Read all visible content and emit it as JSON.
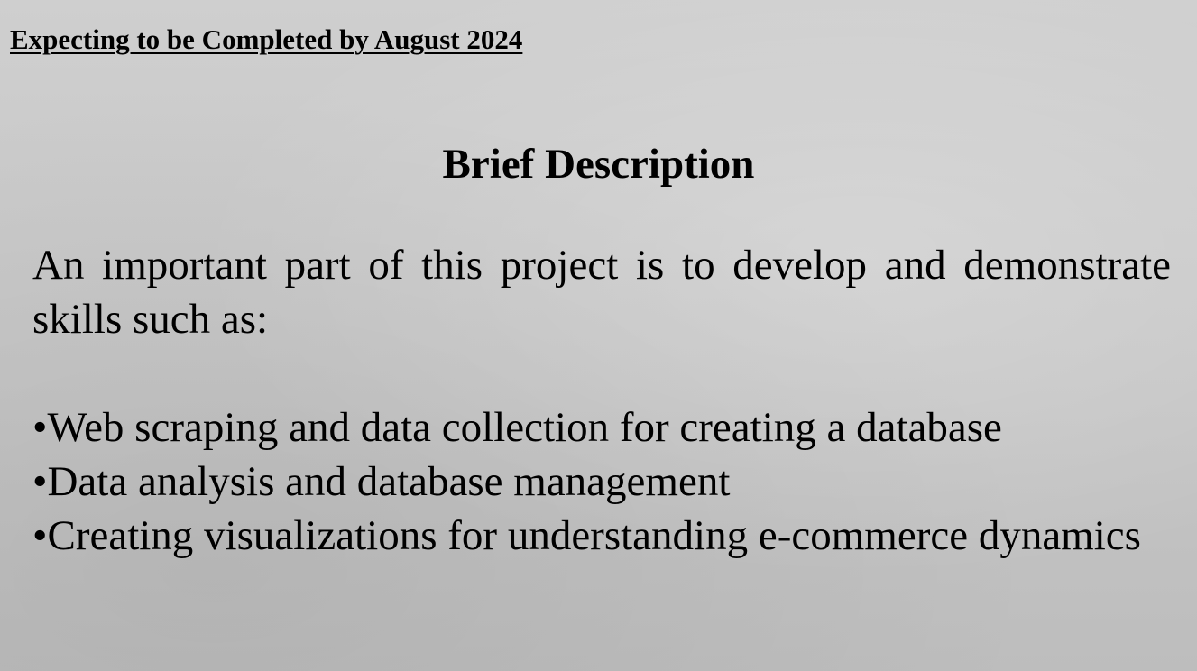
{
  "header": {
    "completion_note": "Expecting to be Completed by August 2024"
  },
  "section": {
    "title": "Brief Description",
    "intro": "An important part of this project is to develop and demonstrate skills such as:",
    "bullet_symbol": "•",
    "skills": [
      "Web scraping and data collection for creating a database",
      "Data analysis and database management",
      "Creating visualizations for understanding e-commerce dynamics"
    ]
  }
}
